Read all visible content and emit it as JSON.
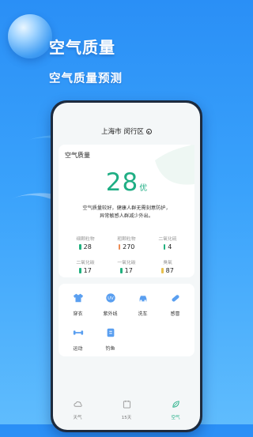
{
  "promo": {
    "headline": "空气质量",
    "subline": "空气质量预测"
  },
  "location": {
    "city": "上海市 闵行区",
    "icon": "location-target-icon"
  },
  "air_card": {
    "title": "空气质量",
    "aqi": "28",
    "level": "优",
    "advice_line1": "空气质量较好，健康人群无需刻意防护，",
    "advice_line2": "异常敏感人群减少外出。",
    "pollutants": [
      {
        "name": "细颗粒物",
        "value": "28",
        "color": "#21b07e"
      },
      {
        "name": "粗颗粒物",
        "value": "270",
        "color": "#ec8a53"
      },
      {
        "name": "二氧化硫",
        "value": "4",
        "color": "#21b07e"
      },
      {
        "name": "二氧化碳",
        "value": "17",
        "color": "#21b07e"
      },
      {
        "name": "一氧化碳",
        "value": "17",
        "color": "#21b07e"
      },
      {
        "name": "臭氧",
        "value": "87",
        "color": "#e8c14e"
      }
    ]
  },
  "life_card": {
    "items": [
      {
        "label": "穿衣",
        "icon": "clothes-icon"
      },
      {
        "label": "紫外线",
        "icon": "uv-icon"
      },
      {
        "label": "洗车",
        "icon": "car-wash-icon"
      },
      {
        "label": "感冒",
        "icon": "pill-icon"
      },
      {
        "label": "运动",
        "icon": "dumbbell-icon"
      },
      {
        "label": "钓鱼",
        "icon": "fishing-icon"
      }
    ]
  },
  "tabbar": {
    "tabs": [
      {
        "label": "天气",
        "icon": "weather-icon"
      },
      {
        "label": "15天",
        "icon": "calendar-icon"
      },
      {
        "label": "空气",
        "icon": "air-leaf-icon",
        "active": true
      }
    ]
  },
  "colors": {
    "accent": "#1fae84",
    "background": "#2a8ff6",
    "life_icon": "#5a9ff0"
  }
}
